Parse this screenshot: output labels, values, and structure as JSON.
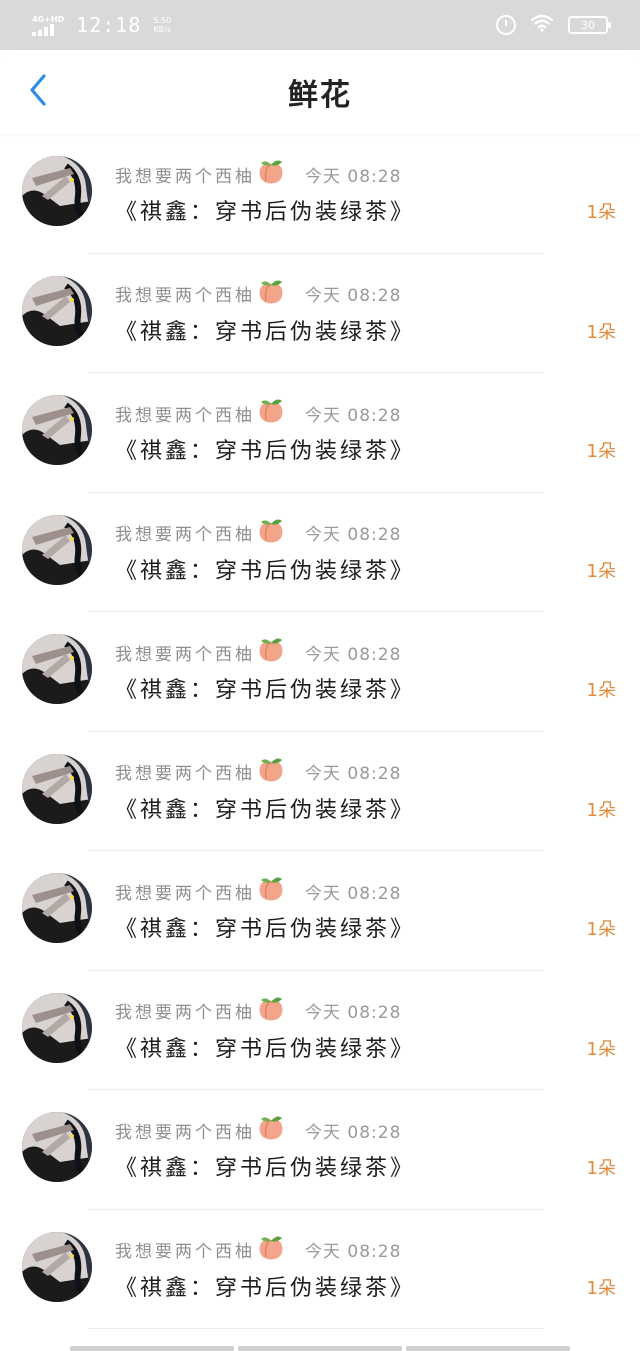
{
  "status_bar": {
    "network": "4G+HD",
    "time": "12:18",
    "speed_value": "5.50",
    "speed_unit": "KB/s",
    "battery": "30"
  },
  "header": {
    "title": "鲜花",
    "back_icon": "chevron-left-icon"
  },
  "colors": {
    "accent_blue": "#2a8ee6",
    "count_orange": "#e08a3c"
  },
  "items": [
    {
      "user": "我想要两个西柚",
      "emoji": "peach",
      "time": "今天 08:28",
      "title": "《祺鑫：穿书后伪装绿茶》",
      "count": "1朵"
    },
    {
      "user": "我想要两个西柚",
      "emoji": "peach",
      "time": "今天 08:28",
      "title": "《祺鑫：穿书后伪装绿茶》",
      "count": "1朵"
    },
    {
      "user": "我想要两个西柚",
      "emoji": "peach",
      "time": "今天 08:28",
      "title": "《祺鑫：穿书后伪装绿茶》",
      "count": "1朵"
    },
    {
      "user": "我想要两个西柚",
      "emoji": "peach",
      "time": "今天 08:28",
      "title": "《祺鑫：穿书后伪装绿茶》",
      "count": "1朵"
    },
    {
      "user": "我想要两个西柚",
      "emoji": "peach",
      "time": "今天 08:28",
      "title": "《祺鑫：穿书后伪装绿茶》",
      "count": "1朵"
    },
    {
      "user": "我想要两个西柚",
      "emoji": "peach",
      "time": "今天 08:28",
      "title": "《祺鑫：穿书后伪装绿茶》",
      "count": "1朵"
    },
    {
      "user": "我想要两个西柚",
      "emoji": "peach",
      "time": "今天 08:28",
      "title": "《祺鑫：穿书后伪装绿茶》",
      "count": "1朵"
    },
    {
      "user": "我想要两个西柚",
      "emoji": "peach",
      "time": "今天 08:28",
      "title": "《祺鑫：穿书后伪装绿茶》",
      "count": "1朵"
    },
    {
      "user": "我想要两个西柚",
      "emoji": "peach",
      "time": "今天 08:28",
      "title": "《祺鑫：穿书后伪装绿茶》",
      "count": "1朵"
    },
    {
      "user": "我想要两个西柚",
      "emoji": "peach",
      "time": "今天 08:28",
      "title": "《祺鑫：穿书后伪装绿茶》",
      "count": "1朵"
    }
  ]
}
